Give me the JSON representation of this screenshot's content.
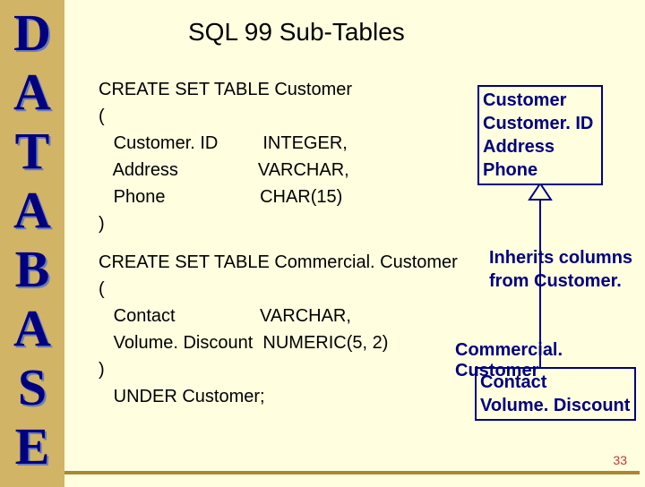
{
  "sidebar": {
    "letters": [
      "D",
      "A",
      "T",
      "A",
      "B",
      "A",
      "S",
      "E"
    ]
  },
  "slide": {
    "title": "SQL 99 Sub-Tables",
    "sql1": "CREATE SET TABLE Customer\n(\n   Customer. ID         INTEGER,\n   Address                VARCHAR,\n   Phone                   CHAR(15)\n)",
    "sql2": "CREATE SET TABLE Commercial. Customer\n(\n   Contact                 VARCHAR,\n   Volume. Discount  NUMERIC(5, 2)\n)\n   UNDER Customer;",
    "customer_box": {
      "title": "Customer",
      "rows": [
        "Customer. ID",
        "Address",
        "Phone"
      ]
    },
    "inherits_note": "Inherits columns\nfrom Customer.",
    "cc_label": "Commercial. Customer",
    "cc_box": {
      "rows": [
        "Contact",
        "Volume. Discount"
      ]
    },
    "page_number": "33"
  }
}
